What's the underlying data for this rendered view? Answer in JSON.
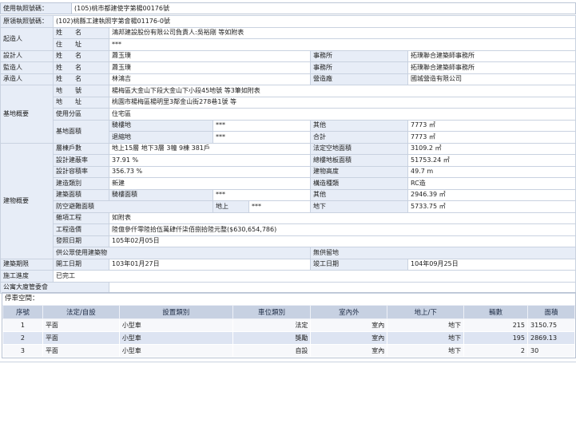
{
  "header": {
    "permit_label": "使用執照號碼：",
    "permit_value": "(105)桃市都建使字第楊00176號"
  },
  "building_permit": {
    "label": "原領執照號碼：",
    "value": "(102)桃縣工建執照字第會楊01176-0號"
  },
  "applicant": {
    "section": "起造人",
    "name_label": "姓　　名",
    "name": "鴻邦建設股份有限公司負責人:吳裕剛 等如附表",
    "addr_label": "住　　址",
    "addr": "***"
  },
  "designer": {
    "section": "設計人",
    "name_label": "姓　　名",
    "name": "蕭玉璞",
    "office_label": "事務所",
    "office": "拓璞聯合建築師事務所"
  },
  "supervisor": {
    "section": "監造人",
    "name_label": "姓　　名",
    "name": "蕭玉璞",
    "office_label": "事務所",
    "office": "拓璞聯合建築師事務所"
  },
  "contractor": {
    "section": "承造人",
    "name_label": "姓　　名",
    "name": "林鴻吉",
    "firm_label": "營造廠",
    "firm": "國城營造有限公司"
  },
  "site": {
    "section": "基地概要",
    "lot_label": "地　　號",
    "lot": "楊梅區大金山下段大金山下小段45地號 等3筆如附表",
    "addr_label": "地　　址",
    "addr": "桃園市楊梅區楊明里3鄰金山街278巷1號 等",
    "use_label": "使用分區",
    "use": "住宅區",
    "area_label": "基地面積",
    "bldg_land_label": "騎樓地",
    "bldg_land": "***",
    "other_label": "其他",
    "other": "7773 ㎡",
    "retreat_label": "退縮地",
    "retreat": "***",
    "total_label": "合計",
    "total": "7773 ㎡"
  },
  "building": {
    "section": "建物概要",
    "floors_label": "層棟戶數",
    "floors": "地上15層 地下3層 3幢 9棟 381戶",
    "legal_open_label": "法定空地面積",
    "legal_open": "3109.2 ㎡",
    "coverage_label": "設計建蔽率",
    "coverage": "37.91 %",
    "total_floor_label": "總樓地板面積",
    "total_floor": "51753.24 ㎡",
    "far_label": "設計容積率",
    "far": "356.73 %",
    "height_label": "建物高度",
    "height": "49.7 m",
    "category_label": "建造類別",
    "category": "新建",
    "structure_label": "構造種類",
    "structure": "RC造",
    "bldg_area_label": "建築面積",
    "arcade_label": "騎樓面積",
    "arcade": "***",
    "bldg_other_label": "其他",
    "bldg_other": "2946.39 ㎡",
    "shelter_label": "防空避難面積",
    "above_label": "地上",
    "above": "***",
    "below_label": "地下",
    "below": "5733.75 ㎡",
    "misc_label": "雜項工程",
    "misc": "如附表",
    "cost_label": "工程造價",
    "cost": "陸億參仟零陸拾伍萬肆仟柒佰捌拾陸元整($630,654,786)",
    "issue_label": "發照日期",
    "issue": "105年02月05日",
    "public_label": "供公眾使用建築物",
    "no_open_label": "無供留地"
  },
  "construction": {
    "section": "建築期限",
    "start_label": "開工日期",
    "start": "103年01月27日",
    "done_label": "竣工日期",
    "done": "104年09月25日"
  },
  "status": {
    "label": "施工進度",
    "value": "已完工"
  },
  "management": {
    "label": "公寓大廈管委會"
  },
  "parking": {
    "title": "停車空間：",
    "headers": [
      "序號",
      "法定/自設",
      "設置類別",
      "車位類別",
      "室內外",
      "地上/下",
      "輛數",
      "面積"
    ],
    "rows": [
      {
        "no": "1",
        "type": "平面",
        "kind": "小型車",
        "cat": "法定",
        "io": "室內",
        "level": "地下",
        "count": "215",
        "area": "3150.75"
      },
      {
        "no": "2",
        "type": "平面",
        "kind": "小型車",
        "cat": "獎勵",
        "io": "室內",
        "level": "地下",
        "count": "195",
        "area": "2869.13"
      },
      {
        "no": "3",
        "type": "平面",
        "kind": "小型車",
        "cat": "自設",
        "io": "室內",
        "level": "地下",
        "count": "2",
        "area": "30"
      }
    ]
  }
}
